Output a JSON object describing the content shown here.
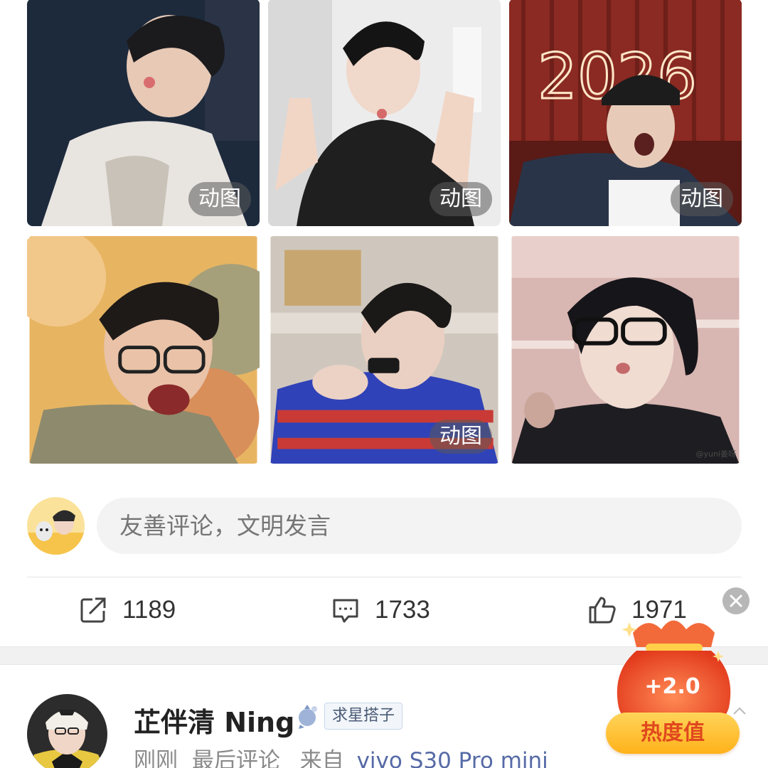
{
  "grid": {
    "gif_label": "动图",
    "images": [
      {
        "has_gif_badge": true
      },
      {
        "has_gif_badge": true
      },
      {
        "has_gif_badge": true
      },
      {
        "has_gif_badge": false
      },
      {
        "has_gif_badge": true
      },
      {
        "has_gif_badge": false
      }
    ],
    "image3_text": "2026",
    "watermark": "@yuni姜呀"
  },
  "comment_box": {
    "placeholder": "友善评论，文明发言"
  },
  "actions": {
    "repost_count": "1189",
    "comment_count": "1733",
    "like_count": "1971"
  },
  "commenter": {
    "name": "芷伴清 Ning",
    "badge": "求星搭子",
    "time": "刚刚",
    "status": "最后评论",
    "from_label": "来自",
    "device": "vivo S30 Pro mini"
  },
  "promo": {
    "value": "+2.0",
    "button_label": "热度值"
  },
  "colors": {
    "link_blue": "#566aa6",
    "promo_red": "#f0542a",
    "promo_gold": "#ffc43a"
  }
}
